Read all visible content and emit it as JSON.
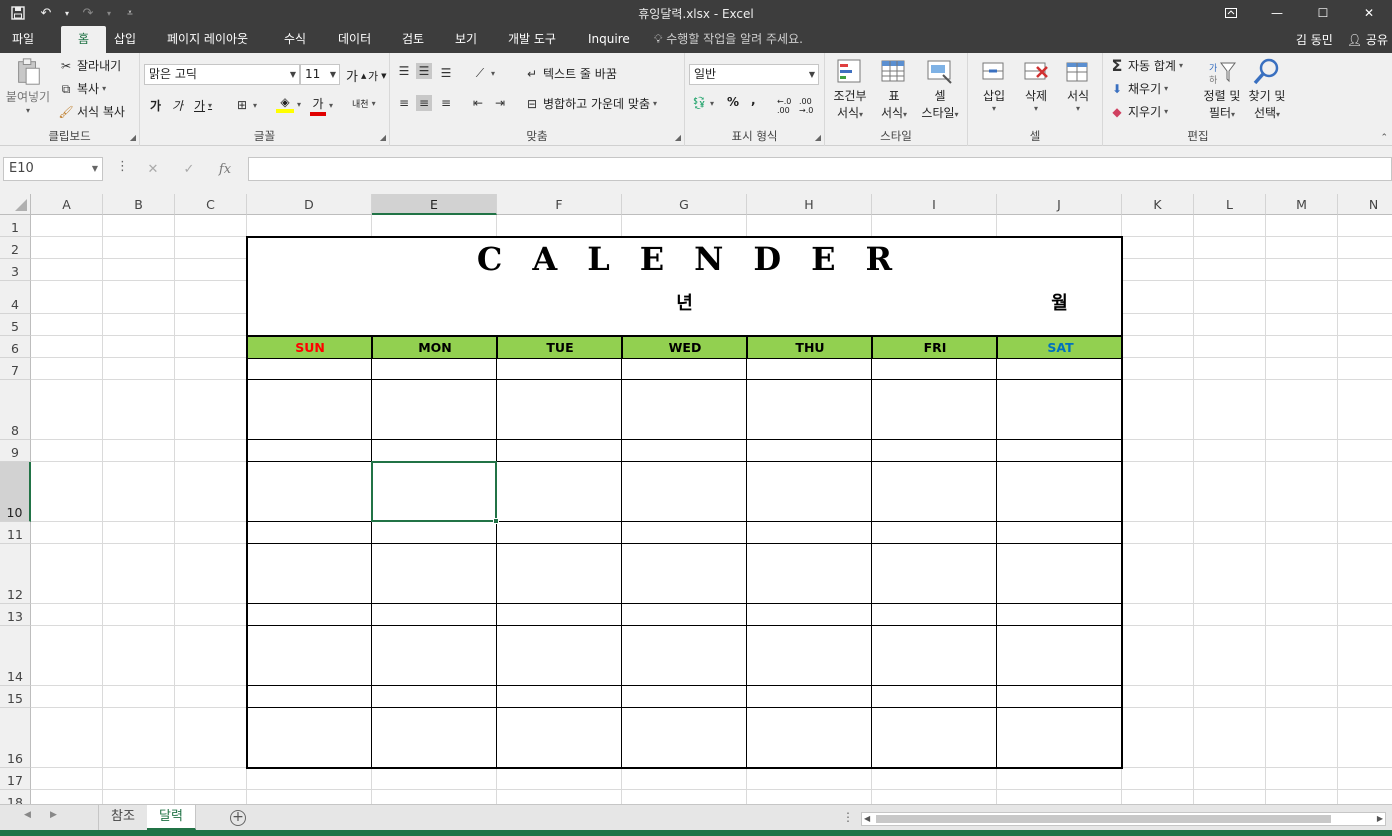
{
  "window": {
    "title": "휴잉달력.xlsx - Excel",
    "qat": [
      "save-icon",
      "undo-icon",
      "redo-icon",
      "customize-icon"
    ]
  },
  "ribbon_tabs": [
    "파일",
    "홈",
    "삽입",
    "페이지 레이아웃",
    "수식",
    "데이터",
    "검토",
    "보기",
    "개발 도구",
    "Inquire"
  ],
  "tell_me": "수행할 작업을 알려 주세요.",
  "user": "김 동민",
  "share": "공유",
  "clipboard": {
    "paste": "붙여넣기",
    "cut": "잘라내기",
    "copy": "복사",
    "format_painter": "서식 복사",
    "label": "클립보드"
  },
  "font": {
    "name": "맑은 고딕",
    "size": "11",
    "grow": "가",
    "shrink": "가",
    "bold": "가",
    "italic": "가",
    "underline": "가",
    "color_letter": "가",
    "phonetic": "내천",
    "label": "글꼴"
  },
  "alignment": {
    "wrap_text": "텍스트 줄 바꿈",
    "merge_center": "병합하고 가운데 맞춤",
    "label": "맞춤"
  },
  "number": {
    "format": "일반",
    "percent": "%",
    "comma": ",",
    "label": "표시 형식"
  },
  "styles": {
    "conditional_top": "조건부",
    "conditional_bottom": "서식",
    "table_top": "표",
    "table_bottom": "서식",
    "cell_top": "셀",
    "cell_bottom": "스타일",
    "label": "스타일"
  },
  "cells": {
    "insert": "삽입",
    "delete": "삭제",
    "format": "서식",
    "label": "셀"
  },
  "editing": {
    "autosum": "자동 합계",
    "fill": "채우기",
    "clear": "지우기",
    "sort_top": "정렬 및",
    "sort_bottom": "필터",
    "find_top": "찾기 및",
    "find_bottom": "선택",
    "label": "편집"
  },
  "formula_bar": {
    "name_box": "E10",
    "cancel": "✕",
    "enter": "✓",
    "fx": "fx",
    "value": ""
  },
  "columns": [
    "A",
    "B",
    "C",
    "D",
    "E",
    "F",
    "G",
    "H",
    "I",
    "J",
    "K",
    "L",
    "M",
    "N"
  ],
  "rows": [
    "1",
    "2",
    "3",
    "4",
    "5",
    "6",
    "7",
    "8",
    "9",
    "10",
    "11",
    "12",
    "13",
    "14",
    "15",
    "16",
    "17",
    "18"
  ],
  "selected_column": "E",
  "selected_row": "10",
  "calendar": {
    "title": "CALENDER",
    "year_label": "년",
    "month_label": "월",
    "days": [
      {
        "label": "SUN",
        "color": "#ff0000"
      },
      {
        "label": "MON",
        "color": "#000000"
      },
      {
        "label": "TUE",
        "color": "#000000"
      },
      {
        "label": "WED",
        "color": "#000000"
      },
      {
        "label": "THU",
        "color": "#000000"
      },
      {
        "label": "FRI",
        "color": "#000000"
      },
      {
        "label": "SAT",
        "color": "#0070c0"
      }
    ],
    "header_fill": "#92d050"
  },
  "sheets": {
    "tabs": [
      "참조",
      "달력"
    ],
    "active": "달력"
  },
  "colors": {
    "excel_green": "#217346",
    "titlebar": "#3d3d3d"
  }
}
